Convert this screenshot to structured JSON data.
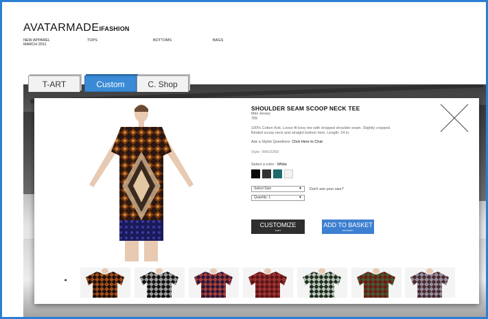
{
  "brand": {
    "main": "AVATARMADE",
    "sub": "IFASHION"
  },
  "topnav": [
    {
      "label": "NEW APPAREL",
      "sub": "MARCH 2011"
    },
    {
      "label": "TOPS",
      "sub": ""
    },
    {
      "label": "BOTTOMS",
      "sub": ""
    },
    {
      "label": "BAGS",
      "sub": ""
    }
  ],
  "tabs": [
    {
      "label": "T-ART"
    },
    {
      "label": "Custom"
    },
    {
      "label": "C. Shop"
    }
  ],
  "product": {
    "title": "SHOULDER SEAM SCOOP NECK TEE",
    "subtitle": "Mini Jersey",
    "price": "765",
    "description": "100% Cotton Knit. Loose fit boxy tee with dropped shoulder seam. Slightly cropped. Binded scoop neck and straight bottom hem. Length: 24 in.",
    "stylist_prefix": "Ask a Stylist Questions:",
    "stylist_link": "Click Here to Chat",
    "style_code": "Style: WMJ3358",
    "color_prefix": "Select a color :",
    "color_value": "White"
  },
  "swatch_colors": [
    "#0a0a0a",
    "#333333",
    "#1f6a6a",
    "#f2f2f2"
  ],
  "selects": {
    "size": "Select Size",
    "quantity": "Quantity: 1",
    "size_note": "Don't see your size?",
    "arrow": "▼"
  },
  "buttons": {
    "customize": "CUSTOMIZE",
    "customize_sub": "SHIFT",
    "basket": "ADD TO BASKET",
    "basket_sub": "WE VERIFY"
  },
  "carousel": {
    "prev": "◄",
    "thumb_colors": [
      {
        "bg": "#1b120c",
        "accent": "#c85a1e"
      },
      {
        "bg": "#121212",
        "accent": "#bdbdbd"
      },
      {
        "bg": "#2b1838",
        "accent": "#c7493a"
      },
      {
        "bg": "#5a1616",
        "accent": "#b03a3a"
      },
      {
        "bg": "#1e2d1e",
        "accent": "#dfe9df"
      },
      {
        "bg": "#6e1a14",
        "accent": "#3a6a3a"
      },
      {
        "bg": "#4a2a30",
        "accent": "#a9a9b8"
      }
    ]
  }
}
